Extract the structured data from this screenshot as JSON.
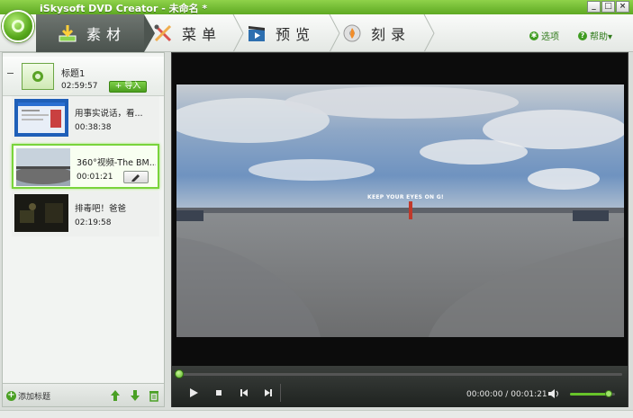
{
  "window": {
    "title": "iSkysoft DVD Creator - 未命名 *",
    "buttons": [
      "_",
      "□",
      "×"
    ]
  },
  "tabs": [
    {
      "label": "素材",
      "active": true,
      "icon": "import-icon"
    },
    {
      "label": "菜单",
      "active": false,
      "icon": "menu-tools-icon"
    },
    {
      "label": "预览",
      "active": false,
      "icon": "clapperboard-icon"
    },
    {
      "label": "刻录",
      "active": false,
      "icon": "burn-disc-icon"
    }
  ],
  "toolbar_links": {
    "options": "选项",
    "help": "帮助▾"
  },
  "project": {
    "title": "标题1",
    "duration": "02:59:57",
    "import_label": "+ 导入"
  },
  "items": [
    {
      "title": "用事实说话，看...",
      "duration": "00:38:38",
      "selected": false
    },
    {
      "title": "360°视频-The BM...",
      "duration": "00:01:21",
      "selected": true
    },
    {
      "title": "排毒吧！爸爸",
      "duration": "02:19:58",
      "selected": false
    }
  ],
  "left_bottom": {
    "add_title": "添加标题"
  },
  "video": {
    "caption": "KEEP YOUR EYES ON G!"
  },
  "player": {
    "current_time": "00:00:00",
    "total_time": "00:01:21",
    "time_separator": "/",
    "progress": 0.0,
    "volume": 0.85
  },
  "colors": {
    "accent_green": "#5ea923",
    "selection_border": "#79d43b",
    "preview_bg": "#0c0c0c"
  }
}
